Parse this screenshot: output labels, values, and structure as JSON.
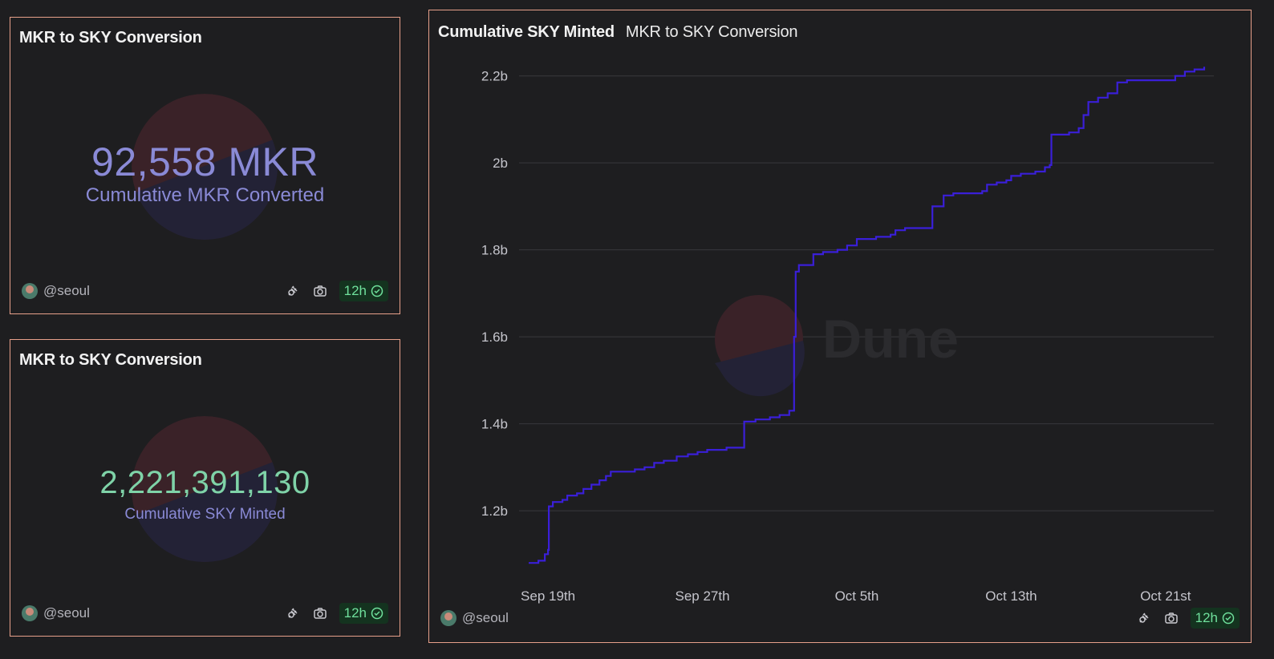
{
  "cards": {
    "mkr_counter": {
      "title": "MKR to SKY Conversion",
      "value": "92,558 MKR",
      "label": "Cumulative MKR Converted"
    },
    "sky_counter": {
      "title": "MKR to SKY Conversion",
      "value": "2,221,391,130",
      "label": "Cumulative SKY Minted"
    },
    "chart_card": {
      "title": "Cumulative SKY Minted",
      "subtitle": "MKR to SKY Conversion"
    }
  },
  "footer": {
    "author": "@seoul",
    "refresh_badge": "12h",
    "icons": [
      "plug-icon",
      "camera-icon",
      "check-circle-icon"
    ]
  },
  "watermark": {
    "text": "Dune"
  },
  "colors": {
    "line": "#3a1fd8",
    "border": "#e7a08a",
    "background": "#1e1e20",
    "counter_purple": "#8a8ad6",
    "counter_green": "#7fd3a8",
    "badge_text": "#6fe09c"
  },
  "chart_data": {
    "type": "line",
    "title": "Cumulative SKY Minted",
    "subtitle": "MKR to SKY Conversion",
    "xlabel": "",
    "ylabel": "",
    "grid": true,
    "ylim": [
      1.06,
      2.24
    ],
    "y_ticks": [
      1.2,
      1.4,
      1.6,
      1.8,
      2.0,
      2.2
    ],
    "y_tick_labels": [
      "1.2b",
      "1.4b",
      "1.6b",
      "1.8b",
      "2b",
      "2.2b"
    ],
    "x_ticks": [
      "Sep 19th",
      "Sep 27th",
      "Oct 5th",
      "Oct 13th",
      "Oct 21st"
    ],
    "series": [
      {
        "unit": "billion SKY",
        "points": [
          [
            "2024-09-18T00:00",
            1.08
          ],
          [
            "2024-09-18T12:00",
            1.085
          ],
          [
            "2024-09-18T20:00",
            1.1
          ],
          [
            "2024-09-19T00:00",
            1.11
          ],
          [
            "2024-09-19T01:00",
            1.21
          ],
          [
            "2024-09-19T06:00",
            1.22
          ],
          [
            "2024-09-19T18:00",
            1.225
          ],
          [
            "2024-09-20T00:00",
            1.235
          ],
          [
            "2024-09-20T12:00",
            1.24
          ],
          [
            "2024-09-20T20:00",
            1.25
          ],
          [
            "2024-09-21T06:00",
            1.26
          ],
          [
            "2024-09-21T16:00",
            1.27
          ],
          [
            "2024-09-22T00:00",
            1.28
          ],
          [
            "2024-09-22T06:00",
            1.29
          ],
          [
            "2024-09-23T00:00",
            1.29
          ],
          [
            "2024-09-23T12:00",
            1.295
          ],
          [
            "2024-09-24T00:00",
            1.3
          ],
          [
            "2024-09-24T12:00",
            1.31
          ],
          [
            "2024-09-25T00:00",
            1.315
          ],
          [
            "2024-09-25T12:00",
            1.315
          ],
          [
            "2024-09-25T16:00",
            1.325
          ],
          [
            "2024-09-26T06:00",
            1.33
          ],
          [
            "2024-09-26T18:00",
            1.335
          ],
          [
            "2024-09-27T06:00",
            1.34
          ],
          [
            "2024-09-28T06:00",
            1.345
          ],
          [
            "2024-09-29T00:00",
            1.345
          ],
          [
            "2024-09-29T04:00",
            1.405
          ],
          [
            "2024-09-29T18:00",
            1.41
          ],
          [
            "2024-09-30T12:00",
            1.415
          ],
          [
            "2024-10-01T00:00",
            1.42
          ],
          [
            "2024-10-01T12:00",
            1.43
          ],
          [
            "2024-10-01T18:00",
            1.6
          ],
          [
            "2024-10-01T20:00",
            1.75
          ],
          [
            "2024-10-02T00:00",
            1.765
          ],
          [
            "2024-10-02T12:00",
            1.765
          ],
          [
            "2024-10-02T18:00",
            1.79
          ],
          [
            "2024-10-03T06:00",
            1.795
          ],
          [
            "2024-10-04T00:00",
            1.8
          ],
          [
            "2024-10-04T12:00",
            1.81
          ],
          [
            "2024-10-05T00:00",
            1.825
          ],
          [
            "2024-10-06T00:00",
            1.83
          ],
          [
            "2024-10-06T18:00",
            1.835
          ],
          [
            "2024-10-07T00:00",
            1.845
          ],
          [
            "2024-10-07T12:00",
            1.85
          ],
          [
            "2024-10-08T20:00",
            1.85
          ],
          [
            "2024-10-08T22:00",
            1.9
          ],
          [
            "2024-10-09T12:00",
            1.925
          ],
          [
            "2024-10-10T00:00",
            1.93
          ],
          [
            "2024-10-11T12:00",
            1.935
          ],
          [
            "2024-10-11T18:00",
            1.95
          ],
          [
            "2024-10-12T06:00",
            1.955
          ],
          [
            "2024-10-12T18:00",
            1.96
          ],
          [
            "2024-10-13T00:00",
            1.97
          ],
          [
            "2024-10-13T12:00",
            1.975
          ],
          [
            "2024-10-14T06:00",
            1.98
          ],
          [
            "2024-10-14T18:00",
            1.99
          ],
          [
            "2024-10-15T00:00",
            1.995
          ],
          [
            "2024-10-15T02:00",
            2.065
          ],
          [
            "2024-10-16T00:00",
            2.07
          ],
          [
            "2024-10-16T12:00",
            2.08
          ],
          [
            "2024-10-16T18:00",
            2.11
          ],
          [
            "2024-10-17T00:00",
            2.14
          ],
          [
            "2024-10-17T12:00",
            2.15
          ],
          [
            "2024-10-18T00:00",
            2.16
          ],
          [
            "2024-10-18T12:00",
            2.185
          ],
          [
            "2024-10-19T00:00",
            2.19
          ],
          [
            "2024-10-20T00:00",
            2.19
          ],
          [
            "2024-10-21T00:00",
            2.19
          ],
          [
            "2024-10-21T12:00",
            2.2
          ],
          [
            "2024-10-22T00:00",
            2.21
          ],
          [
            "2024-10-22T12:00",
            2.215
          ],
          [
            "2024-10-23T00:00",
            2.221
          ]
        ]
      }
    ]
  }
}
